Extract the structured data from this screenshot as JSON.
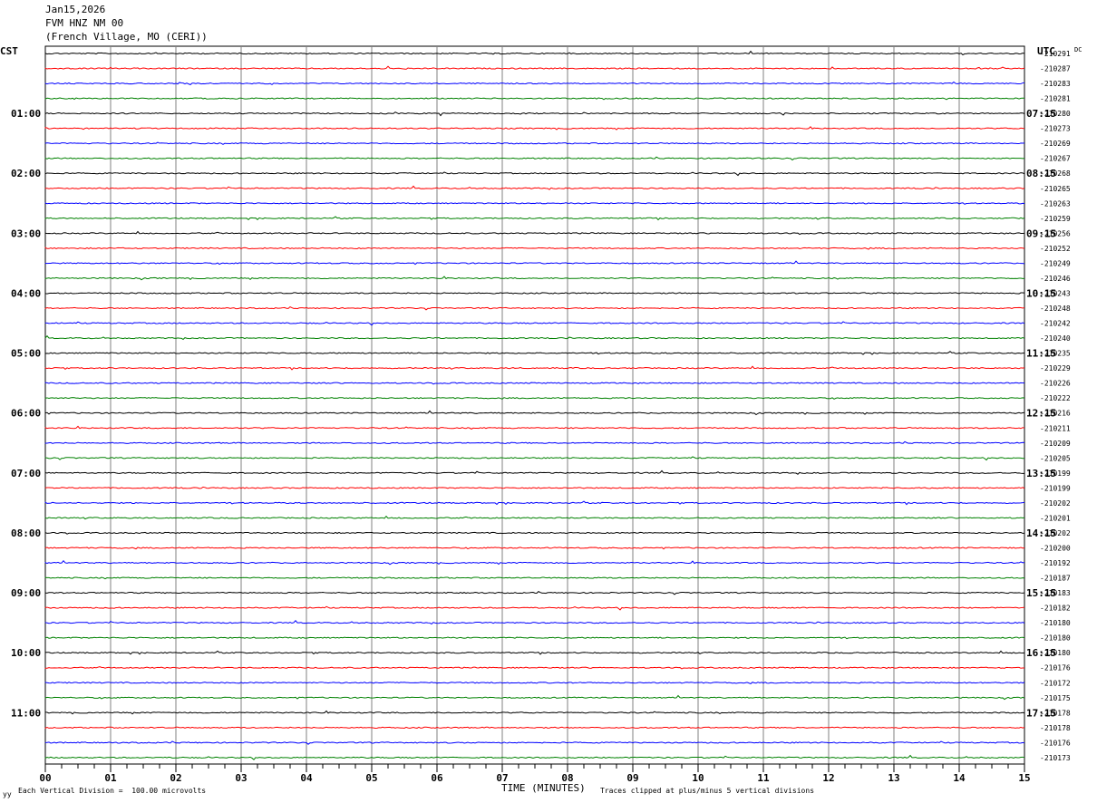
{
  "header": {
    "date": "Jan15,2026",
    "station": "FVM HNZ NM 00",
    "location": "(French Village, MO (CERI))"
  },
  "left_zone": "CST",
  "right_zone": "UTC",
  "dc_label": "DC",
  "footer": {
    "scale_note": "Each Vertical Division =  100.00 microvolts",
    "clip_note": "Traces clipped at plus/minus 5 vertical divisions",
    "corner_mark": "уу"
  },
  "chart_data": {
    "type": "line",
    "title": "",
    "xlabel": "TIME (MINUTES)",
    "x_ticks": [
      "00",
      "01",
      "02",
      "03",
      "04",
      "05",
      "06",
      "07",
      "08",
      "09",
      "10",
      "11",
      "12",
      "13",
      "14",
      "15"
    ],
    "xlim": [
      0,
      15
    ],
    "trace_colors": [
      "#000000",
      "#ff0000",
      "#0000ff",
      "#008000"
    ],
    "grid_color": "#808080",
    "left_hour_labels": [
      "01:00",
      "02:00",
      "03:00",
      "04:00",
      "05:00",
      "06:00",
      "07:00",
      "08:00",
      "09:00",
      "10:00",
      "11:00"
    ],
    "right_hour_labels": [
      "07:15",
      "08:15",
      "09:15",
      "10:15",
      "11:15",
      "12:15",
      "13:15",
      "14:15",
      "15:15",
      "16:15",
      "17:15"
    ],
    "dc_offsets": [
      "210291",
      "210287",
      "210283",
      "210281",
      "210280",
      "210273",
      "210269",
      "210267",
      "210268",
      "210265",
      "210263",
      "210259",
      "210256",
      "210252",
      "210249",
      "210246",
      "210243",
      "210248",
      "210242",
      "210240",
      "210235",
      "210229",
      "210226",
      "210222",
      "210216",
      "210211",
      "210209",
      "210205",
      "210199",
      "210199",
      "210202",
      "210201",
      "210202",
      "210200",
      "210192",
      "210187",
      "210183",
      "210182",
      "210180",
      "210180",
      "210180",
      "210176",
      "210172",
      "210175",
      "210178",
      "210178",
      "210176",
      "210173"
    ]
  }
}
